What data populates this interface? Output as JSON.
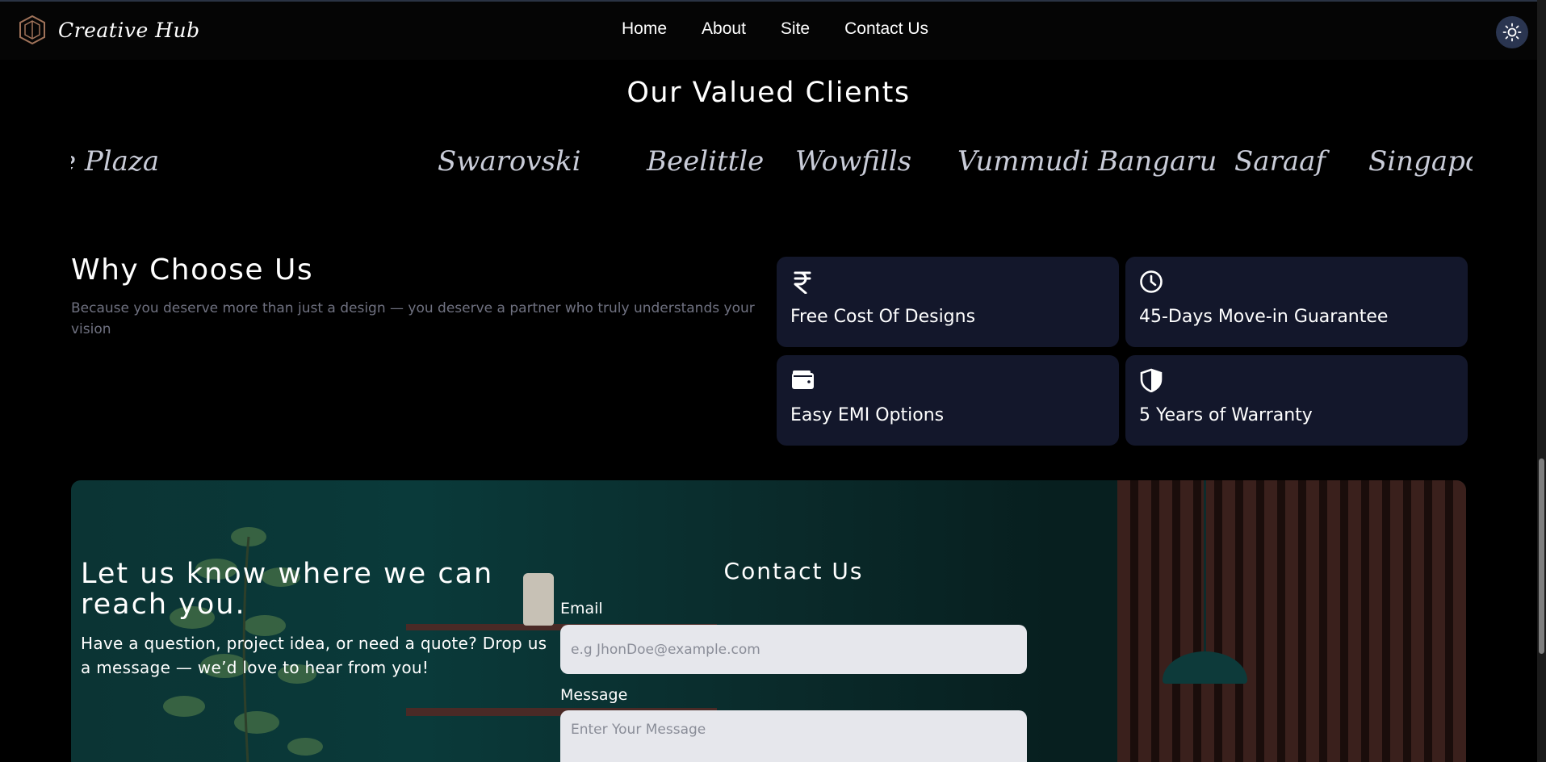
{
  "navbar": {
    "brand": "Creative Hub",
    "links": [
      "Home",
      "About",
      "Site",
      "Contact Us"
    ],
    "logo_icon": "hexagon-logo-icon",
    "toggle_icon": "sun-icon"
  },
  "clients": {
    "title": "Our Valued Clients",
    "names": [
      "e Plaza",
      "Swarovski",
      "Beelittle",
      "Wowfills",
      "Vummudi Bangaru",
      "Saraaf",
      "Singapore"
    ]
  },
  "why": {
    "title": "Why Choose Us",
    "subtitle": "Because you deserve more than just a design — you deserve a partner who truly understands your vision",
    "features": [
      {
        "label": "Free Cost Of Designs",
        "icon": "rupee-icon"
      },
      {
        "label": "45-Days Move-in Guarantee",
        "icon": "clock-icon"
      },
      {
        "label": "Easy EMI Options",
        "icon": "wallet-icon"
      },
      {
        "label": "5 Years of Warranty",
        "icon": "shield-icon"
      }
    ]
  },
  "contact": {
    "reach_title": "Let us know where we can reach you.",
    "reach_sub": "Have a question, project idea, or need a quote? Drop us a message — we’d love to hear from you!",
    "form_title": "Contact Us",
    "email_label": "Email",
    "email_placeholder": "e.g JhonDoe@example.com",
    "message_label": "Message",
    "message_placeholder": "Enter Your Message"
  },
  "colors": {
    "card_bg": "#13172b",
    "banner_teal": "#0a3a3a",
    "toggle_bg": "#2a3550"
  }
}
